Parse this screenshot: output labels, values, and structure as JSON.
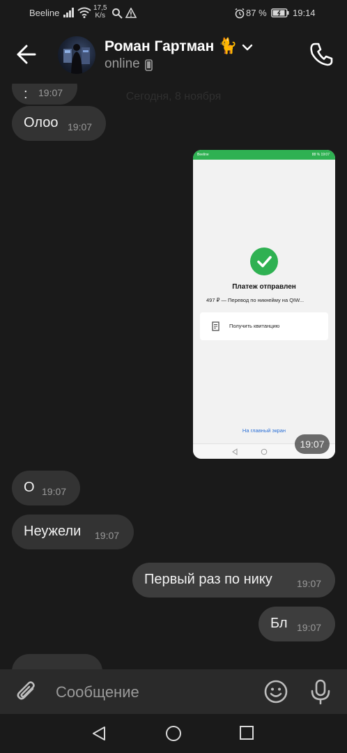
{
  "status_bar": {
    "carrier": "Beeline",
    "speed_value": "17,5",
    "speed_unit": "K/s",
    "battery": "87 %",
    "time": "19:14"
  },
  "header": {
    "contact_name": "Роман Гартман",
    "name_emoji": "🐈",
    "status": "online",
    "back_icon": "arrow-left-icon",
    "call_icon": "phone-icon"
  },
  "chat": {
    "date_separator": "Сегодня, 8 ноября",
    "messages": [
      {
        "direction": "in",
        "text": ":",
        "time": "19:07"
      },
      {
        "direction": "in",
        "text": "Олоо",
        "time": "19:07"
      },
      {
        "direction": "in",
        "type": "image",
        "time": "19:07"
      },
      {
        "direction": "in",
        "text": "О",
        "time": "19:07"
      },
      {
        "direction": "in",
        "text": "Неужели",
        "time": "19:07"
      },
      {
        "direction": "out",
        "text": "Первый раз по нику",
        "time": "19:07"
      },
      {
        "direction": "out",
        "text": "Бл",
        "time": "19:07"
      }
    ],
    "image_content": {
      "status_left": "Beeline",
      "status_right": "88 %  19:07",
      "title": "Платеж отправлен",
      "subtitle": "497 ₽ — Перевод по никнейму на QIW...",
      "receipt_label": "Получить квитанцию",
      "home_link": "На главный экран"
    }
  },
  "composer": {
    "placeholder": "Сообщение",
    "attach_icon": "paperclip-icon",
    "emoji_icon": "smiley-icon",
    "mic_icon": "microphone-icon"
  },
  "colors": {
    "background": "#1a1a1a",
    "bubble": "#333333",
    "composer": "#2a2a2a",
    "accent_green": "#2fb152"
  }
}
